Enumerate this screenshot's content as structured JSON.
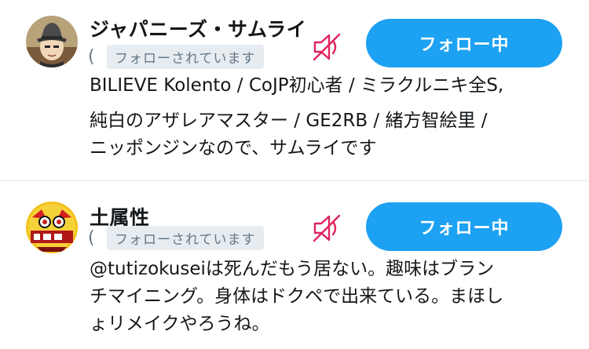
{
  "users": [
    {
      "display_name": "ジャパニーズ・サムライ",
      "handle_fragment": "(",
      "follows_you": "フォローされています",
      "follow_button": "フォロー中",
      "bio_lines": [
        "BILIEVE Kolento / CoJP初心者 / ミラクルニキ全S,",
        "純白のアザレアマスター / GE2RB / 緒方智絵里 /",
        "ニッポンジンなので、サムライです"
      ],
      "avatar_icon": "avatar-samurai-hat",
      "muted_icon": "mute-icon"
    },
    {
      "display_name": "土属性",
      "handle_fragment": "(",
      "follows_you": "フォローされています",
      "follow_button": "フォロー中",
      "bio_lines": [
        "@tutizokuseiは死んだもう居ない。趣味はブラン",
        "チマイニング。身体はドクペで出来ている。まほし",
        "ょリメイクやろうね。"
      ],
      "avatar_icon": "avatar-earth-attribute",
      "muted_icon": "mute-icon"
    }
  ],
  "colors": {
    "accent": "#1da1f2",
    "mute": "#e0245e",
    "badge_bg": "#e6ecf0",
    "muted_text": "#657786"
  }
}
